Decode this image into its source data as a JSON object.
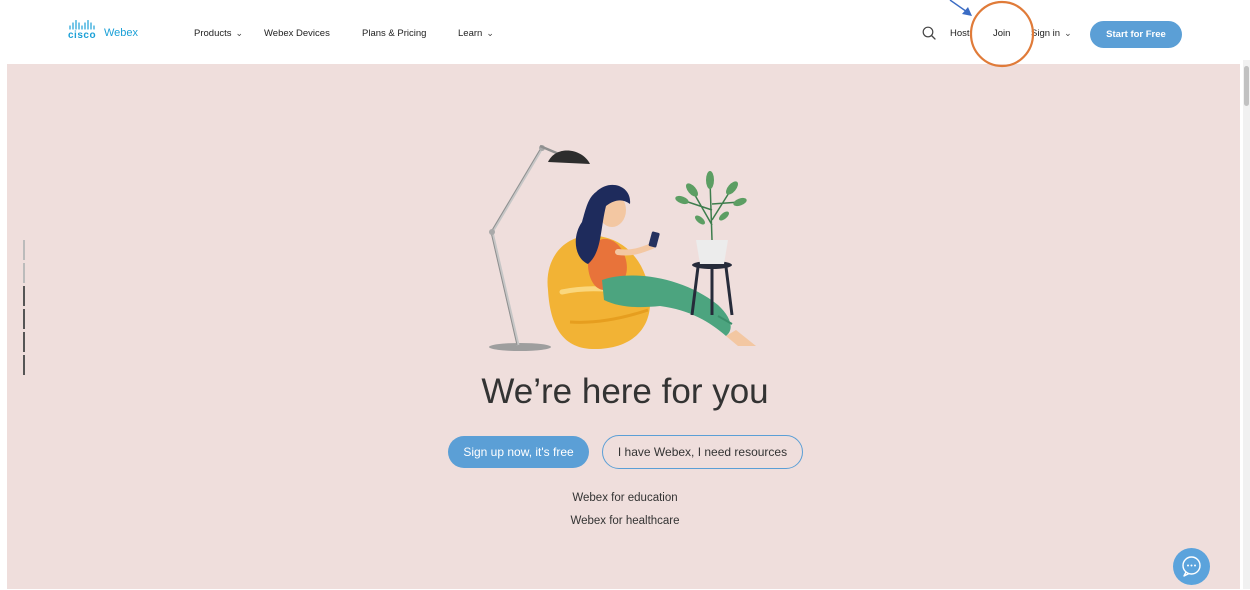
{
  "header": {
    "logo_cisco": "cisco",
    "logo_webex": "Webex",
    "nav": [
      {
        "label": "Products",
        "has_dropdown": true
      },
      {
        "label": "Webex Devices",
        "has_dropdown": false
      },
      {
        "label": "Plans & Pricing",
        "has_dropdown": false
      },
      {
        "label": "Learn",
        "has_dropdown": true
      }
    ],
    "host_label": "Host",
    "join_label": "Join",
    "signin_label": "Sign in",
    "start_label": "Start for Free"
  },
  "hero": {
    "title": "We’re here for you",
    "signup_label": "Sign up now, it's free",
    "resources_label": "I have Webex, I need resources",
    "education_link": "Webex for education",
    "healthcare_link": "Webex for healthcare"
  },
  "icons": {
    "search": "search-icon",
    "chat": "chat-bubble-icon",
    "chevron": "chevron-down-icon"
  },
  "colors": {
    "accent": "#5b9fd6",
    "hero_background": "#efdedc",
    "annotation_circle": "#e07b39",
    "annotation_arrow": "#3b6cc4"
  }
}
